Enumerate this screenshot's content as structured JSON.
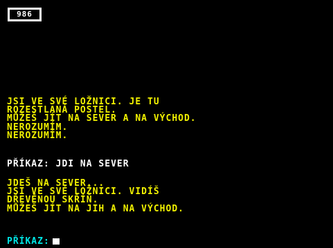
{
  "header": {
    "counter": "986"
  },
  "room1": {
    "lines": [
      "JSI VE SVÉ LOŽNICI. JE TU",
      "ROZESTLANÁ POSTEL.",
      "MŮŽEŠ JÍT NA SEVER A NA VÝCHOD.",
      "NEROZUMÍM.",
      "NEROZUMÍM."
    ]
  },
  "command": {
    "prompt": "PŘÍKAZ:",
    "text": "JDI NA SEVER"
  },
  "room2": {
    "lines": [
      "JDEŠ NA SEVER...",
      "JSI VE SVÉ LOŽNICI. VIDÍŠ",
      "DŘEVĚNOU SKŘÍŇ.",
      "MŮŽEŠ JÍT NA JIH A NA VÝCHOD."
    ]
  },
  "input": {
    "prompt": "PŘÍKAZ:"
  },
  "colors": {
    "background": "#000000",
    "narration": "#f0f000",
    "command": "#ffffff",
    "prompt": "#00e6e6"
  }
}
